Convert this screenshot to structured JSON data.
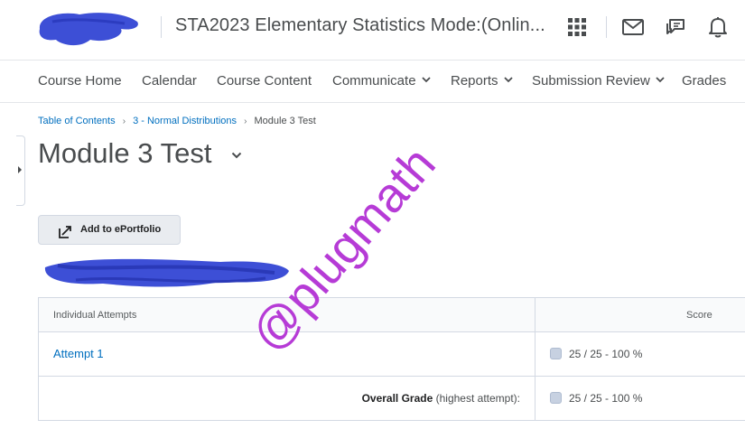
{
  "header": {
    "course_title": "STA2023 Elementary Statistics Mode:(Onlin...",
    "icons": [
      "app-grid-icon",
      "mail-icon",
      "chat-icon",
      "bell-icon"
    ]
  },
  "nav": {
    "items": [
      {
        "label": "Course Home",
        "dropdown": false
      },
      {
        "label": "Calendar",
        "dropdown": false
      },
      {
        "label": "Course Content",
        "dropdown": false
      },
      {
        "label": "Communicate",
        "dropdown": true
      },
      {
        "label": "Reports",
        "dropdown": true
      },
      {
        "label": "Submission Review",
        "dropdown": true
      },
      {
        "label": "Grades",
        "dropdown": false
      }
    ]
  },
  "breadcrumb": {
    "items": [
      "Table of Contents",
      "3 - Normal Distributions"
    ],
    "current": "Module 3 Test"
  },
  "page": {
    "title": "Module 3 Test",
    "eportfolio_label": "Add to ePortfolio"
  },
  "table": {
    "headers": {
      "attempts": "Individual Attempts",
      "score": "Score"
    },
    "attempt_label": "Attempt 1",
    "attempt_score": "25 / 25 - 100 %",
    "overall_label": "Overall Grade",
    "overall_note": "(highest attempt):",
    "overall_score": "25 / 25 - 100 %"
  },
  "watermark": "@plugmath",
  "colors": {
    "link": "#006fbf",
    "text": "#494c4e",
    "watermark": "#b63bd6",
    "redaction": "#3d4fd6"
  }
}
